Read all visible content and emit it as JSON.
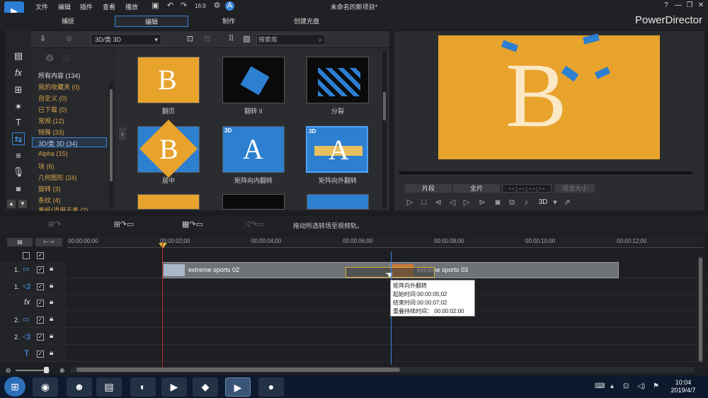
{
  "menu": {
    "file": "文件",
    "edit": "编辑",
    "plugins": "插件",
    "view": "查看",
    "playback": "播放",
    "project_title": "未命名的新项目*",
    "help": "?",
    "app_name": "PowerDirector"
  },
  "modes": {
    "capture": "捕捉",
    "edit": "编辑",
    "produce": "制作",
    "disc": "创建光盘"
  },
  "library": {
    "category_select": "3D/类 3D",
    "search_placeholder": "搜索库"
  },
  "categories": [
    {
      "label": "所有内容 (134)"
    },
    {
      "label": "我的收藏夹 (0)"
    },
    {
      "label": "自定义 (0)"
    },
    {
      "label": "已下载 (0)"
    },
    {
      "label": "常规 (12)"
    },
    {
      "label": "特殊 (33)"
    },
    {
      "label": "3D/类 3D (34)"
    },
    {
      "label": "Alpha (15)"
    },
    {
      "label": "块 (6)"
    },
    {
      "label": "几何图形 (24)"
    },
    {
      "label": "旋转 (3)"
    },
    {
      "label": "条纹 (4)"
    },
    {
      "label": "青纸(适用于青 (2)"
    }
  ],
  "transitions": [
    {
      "name": "翻页"
    },
    {
      "name": "翻转 II"
    },
    {
      "name": "分裂"
    },
    {
      "name": "居中"
    },
    {
      "name": "矩阵向内翻转",
      "badge": "3D"
    },
    {
      "name": "矩阵向外翻转",
      "badge": "3D"
    }
  ],
  "preview": {
    "clip_button": "片段",
    "full_button": "全片",
    "timecode": "- - ; - - ; - - ; - -",
    "fit": "适合大小",
    "mode_3d": "3D"
  },
  "editbar": {
    "hint": "拖动所选转场至视频轨。"
  },
  "ruler": [
    "00:00:00;00",
    "00:00:02;00",
    "00:00:04;00",
    "00:00:06;00",
    "00:00:08;00",
    "00:00:10;00",
    "00:00:12;00"
  ],
  "tracks": [
    {
      "num": "1."
    },
    {
      "num": "1."
    },
    {
      "num": ""
    },
    {
      "num": "2."
    },
    {
      "num": "2."
    },
    {
      "num": ""
    }
  ],
  "clips": {
    "clip1": "extreme sports 02",
    "clip2": "extreme sports 03"
  },
  "tooltip": {
    "line1": "矩阵向外翻转",
    "line2": "起始时间:00:00:05;02",
    "line3": "结束时间:00:00:07;02",
    "line4": "重叠持续时间： 00:00:02:00"
  },
  "taskbar": {
    "time": "10:04",
    "date": "2019/4/7"
  }
}
